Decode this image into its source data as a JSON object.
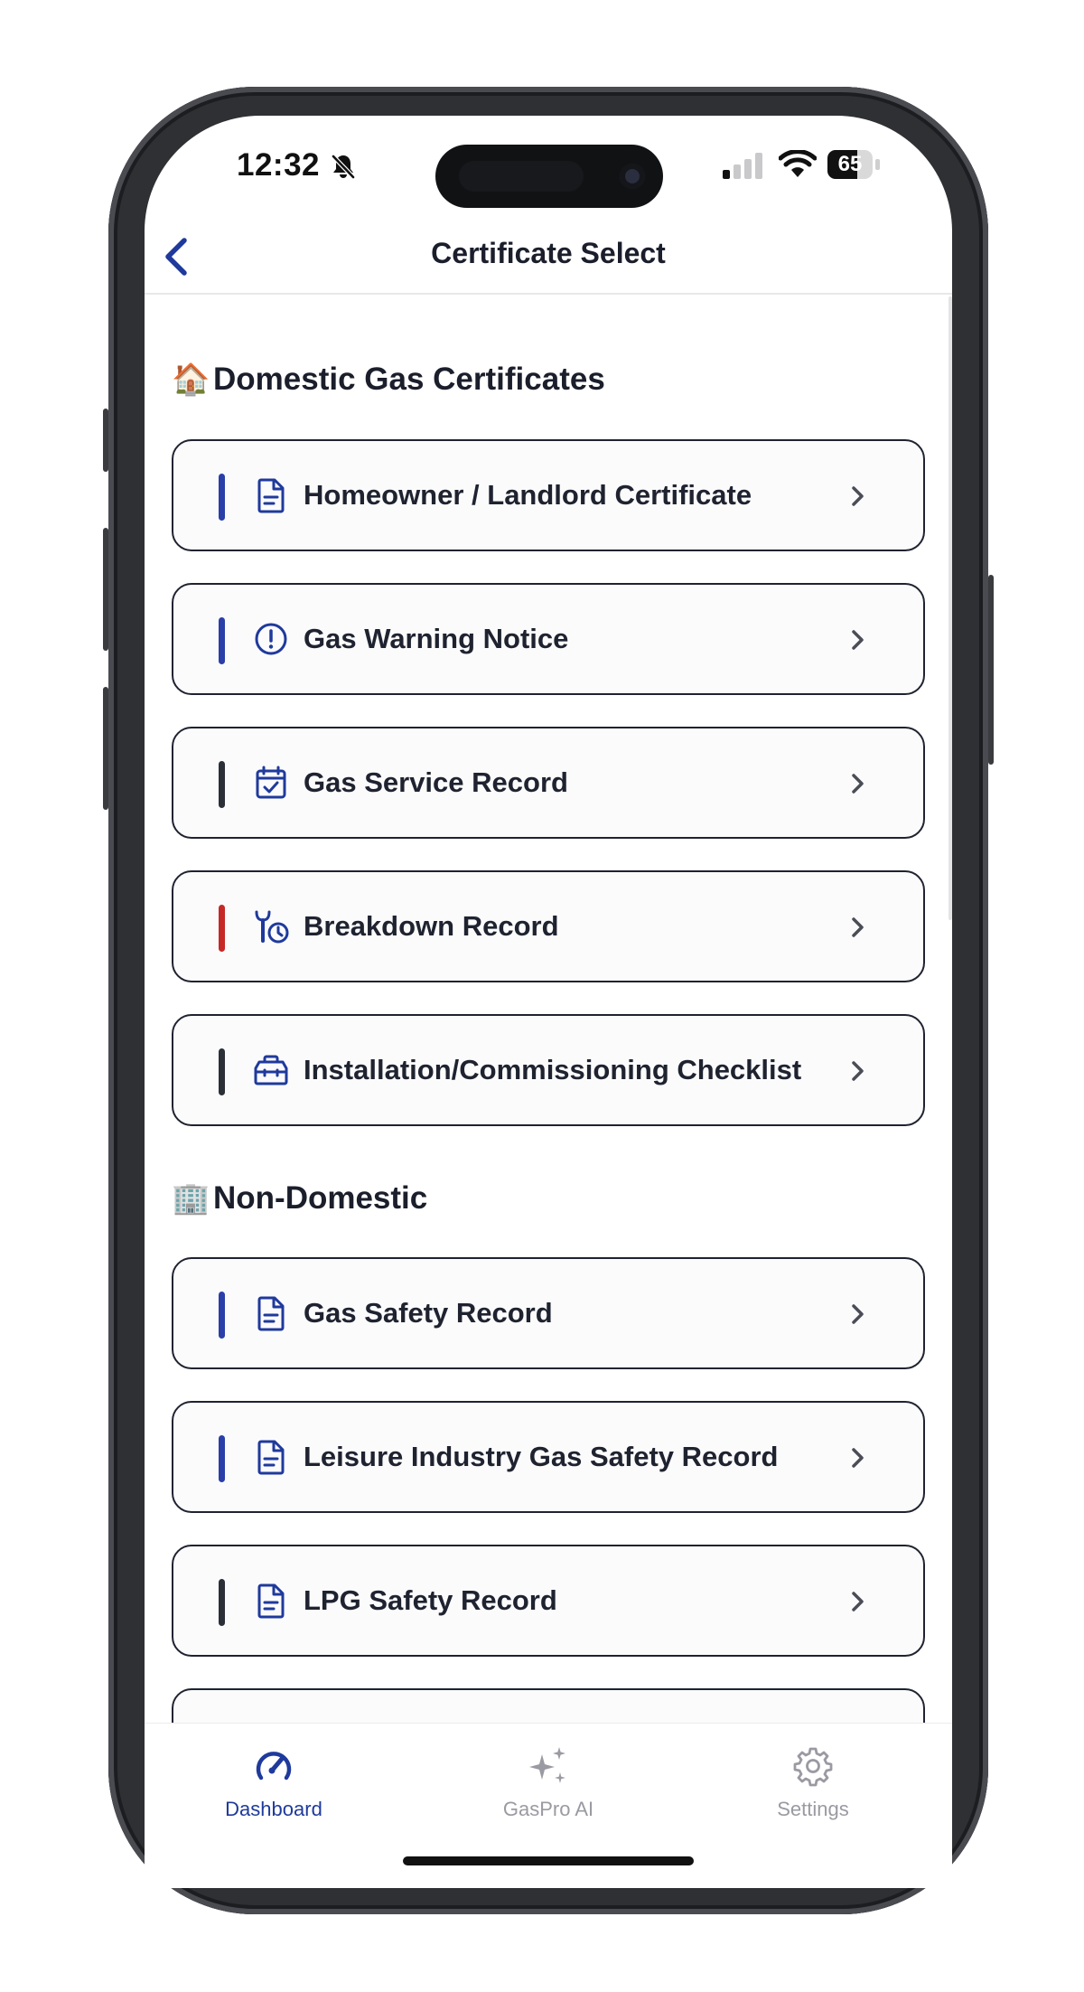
{
  "status_bar": {
    "time": "12:32",
    "battery": "65",
    "battery_level": 0.65
  },
  "nav": {
    "title": "Certificate Select",
    "back_icon": "chevron-left-icon"
  },
  "sections": [
    {
      "emoji": "🏠",
      "title": "Domestic Gas Certificates",
      "items": [
        {
          "label": "Homeowner / Landlord Certificate",
          "icon": "document-icon",
          "accent": "#2a3fa8"
        },
        {
          "label": "Gas Warning Notice",
          "icon": "alert-circle-icon",
          "accent": "#2a3fa8"
        },
        {
          "label": "Gas Service Record",
          "icon": "calendar-check-icon",
          "accent": "#2b2f38"
        },
        {
          "label": "Breakdown Record",
          "icon": "wrench-clock-icon",
          "accent": "#c62828"
        },
        {
          "label": "Installation/Commissioning Checklist",
          "icon": "toolbox-icon",
          "accent": "#2b2f38"
        }
      ]
    },
    {
      "emoji": "🏢",
      "title": "Non-Domestic",
      "items": [
        {
          "label": "Gas Safety Record",
          "icon": "document-icon",
          "accent": "#2a3fa8"
        },
        {
          "label": "Leisure Industry Gas Safety Record",
          "icon": "document-icon",
          "accent": "#2a3fa8"
        },
        {
          "label": "LPG Safety Record",
          "icon": "document-icon",
          "accent": "#2b2f38"
        }
      ]
    }
  ],
  "tabs": [
    {
      "label": "Dashboard",
      "icon": "speedometer-icon",
      "active": true,
      "color": "#1f3a9c"
    },
    {
      "label": "GasPro AI",
      "icon": "sparkles-icon",
      "active": false,
      "color": "#9a9aa2"
    },
    {
      "label": "Settings",
      "icon": "gear-icon",
      "active": false,
      "color": "#9a9aa2"
    }
  ]
}
